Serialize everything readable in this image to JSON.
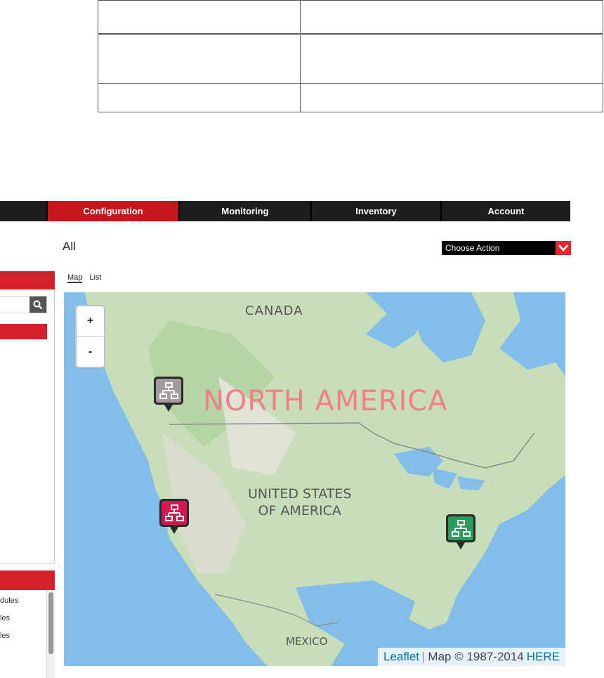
{
  "nav": {
    "items": [
      {
        "label": ""
      },
      {
        "label": "Configuration"
      },
      {
        "label": "Monitoring"
      },
      {
        "label": "Inventory"
      },
      {
        "label": "Account"
      }
    ],
    "active_color": "#c8161d"
  },
  "header": {
    "title": "All",
    "action_select": "Choose Action"
  },
  "view_tabs": {
    "map": "Map",
    "list": "List"
  },
  "sidebar": {
    "list_items": [
      "dules",
      "les",
      "les"
    ]
  },
  "map": {
    "labels": {
      "canada": "CANADA",
      "north_america": "NORTH AMERICA",
      "usa_line1": "UNITED STATES",
      "usa_line2": "OF AMERICA",
      "mexico": "MEXICO"
    },
    "zoom_in": "+",
    "zoom_out": "-",
    "attribution": {
      "leaflet": "Leaflet",
      "separator": "|",
      "copyright": "Map © 1987-2014",
      "provider": "HERE"
    },
    "markers": [
      {
        "name": "gray-site-marker",
        "color": "#a49c9c"
      },
      {
        "name": "red-site-marker",
        "color": "#d7164f"
      },
      {
        "name": "green-site-marker",
        "color": "#2a9d5c"
      }
    ]
  }
}
